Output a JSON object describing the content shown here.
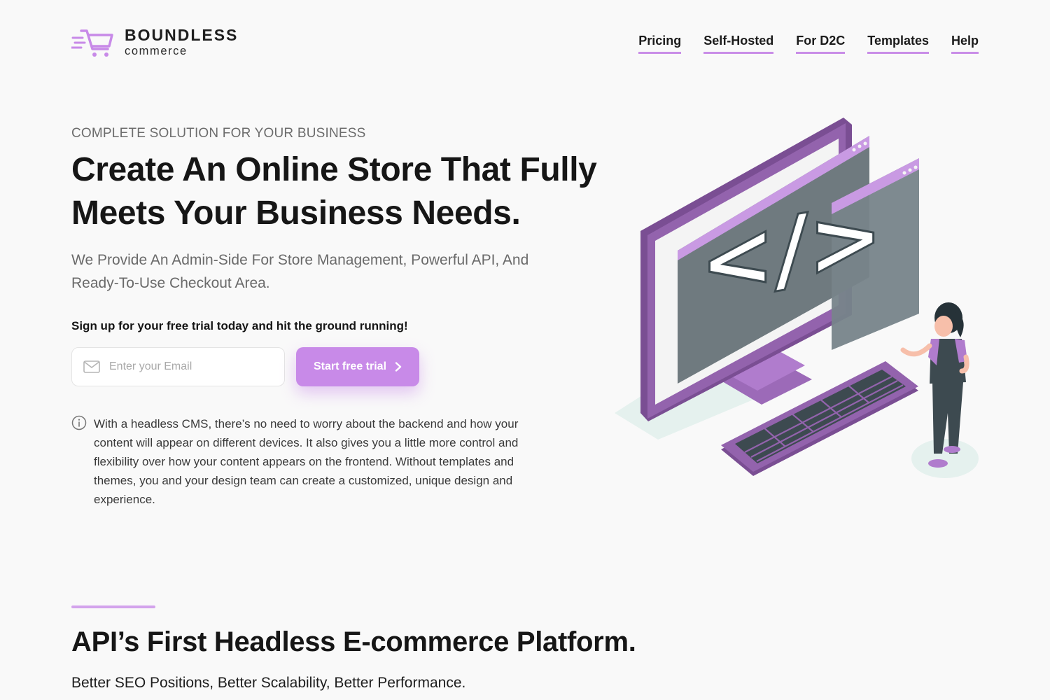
{
  "brand": {
    "name": "BOUNDLESS",
    "sub": "commerce",
    "accent": "#c88ae8"
  },
  "nav": [
    {
      "label": "Pricing"
    },
    {
      "label": "Self-Hosted"
    },
    {
      "label": "For D2C"
    },
    {
      "label": "Templates"
    },
    {
      "label": "Help"
    }
  ],
  "hero": {
    "eyebrow": "COMPLETE SOLUTION FOR YOUR BUSINESS",
    "title": "Create An Online Store That Fully Meets Your Business Needs.",
    "description": "We Provide An Admin-Side For Store Management, Powerful API, And Ready-To-Use Checkout Area.",
    "signup_text": "Sign up for your free trial today and hit the ground running!",
    "email_placeholder": "Enter your Email",
    "email_value": "",
    "cta_label": "Start free trial",
    "info_text": "With a headless CMS, there’s no need to worry about the backend and how your content will appear on different devices. It also gives you a little more control and flexibility over how your content appears on the frontend. Without templates and themes, you and your design team can create a customized, unique design and experience.",
    "code_glyph": "</>"
  },
  "section": {
    "title": "API’s First Headless E-commerce Platform.",
    "subtitle": "Better SEO Positions, Better Scalability, Better Performance."
  },
  "icons": {
    "logo": "cart-icon",
    "email": "envelope-icon",
    "cta": "chevron-right-icon",
    "info": "info-icon"
  }
}
